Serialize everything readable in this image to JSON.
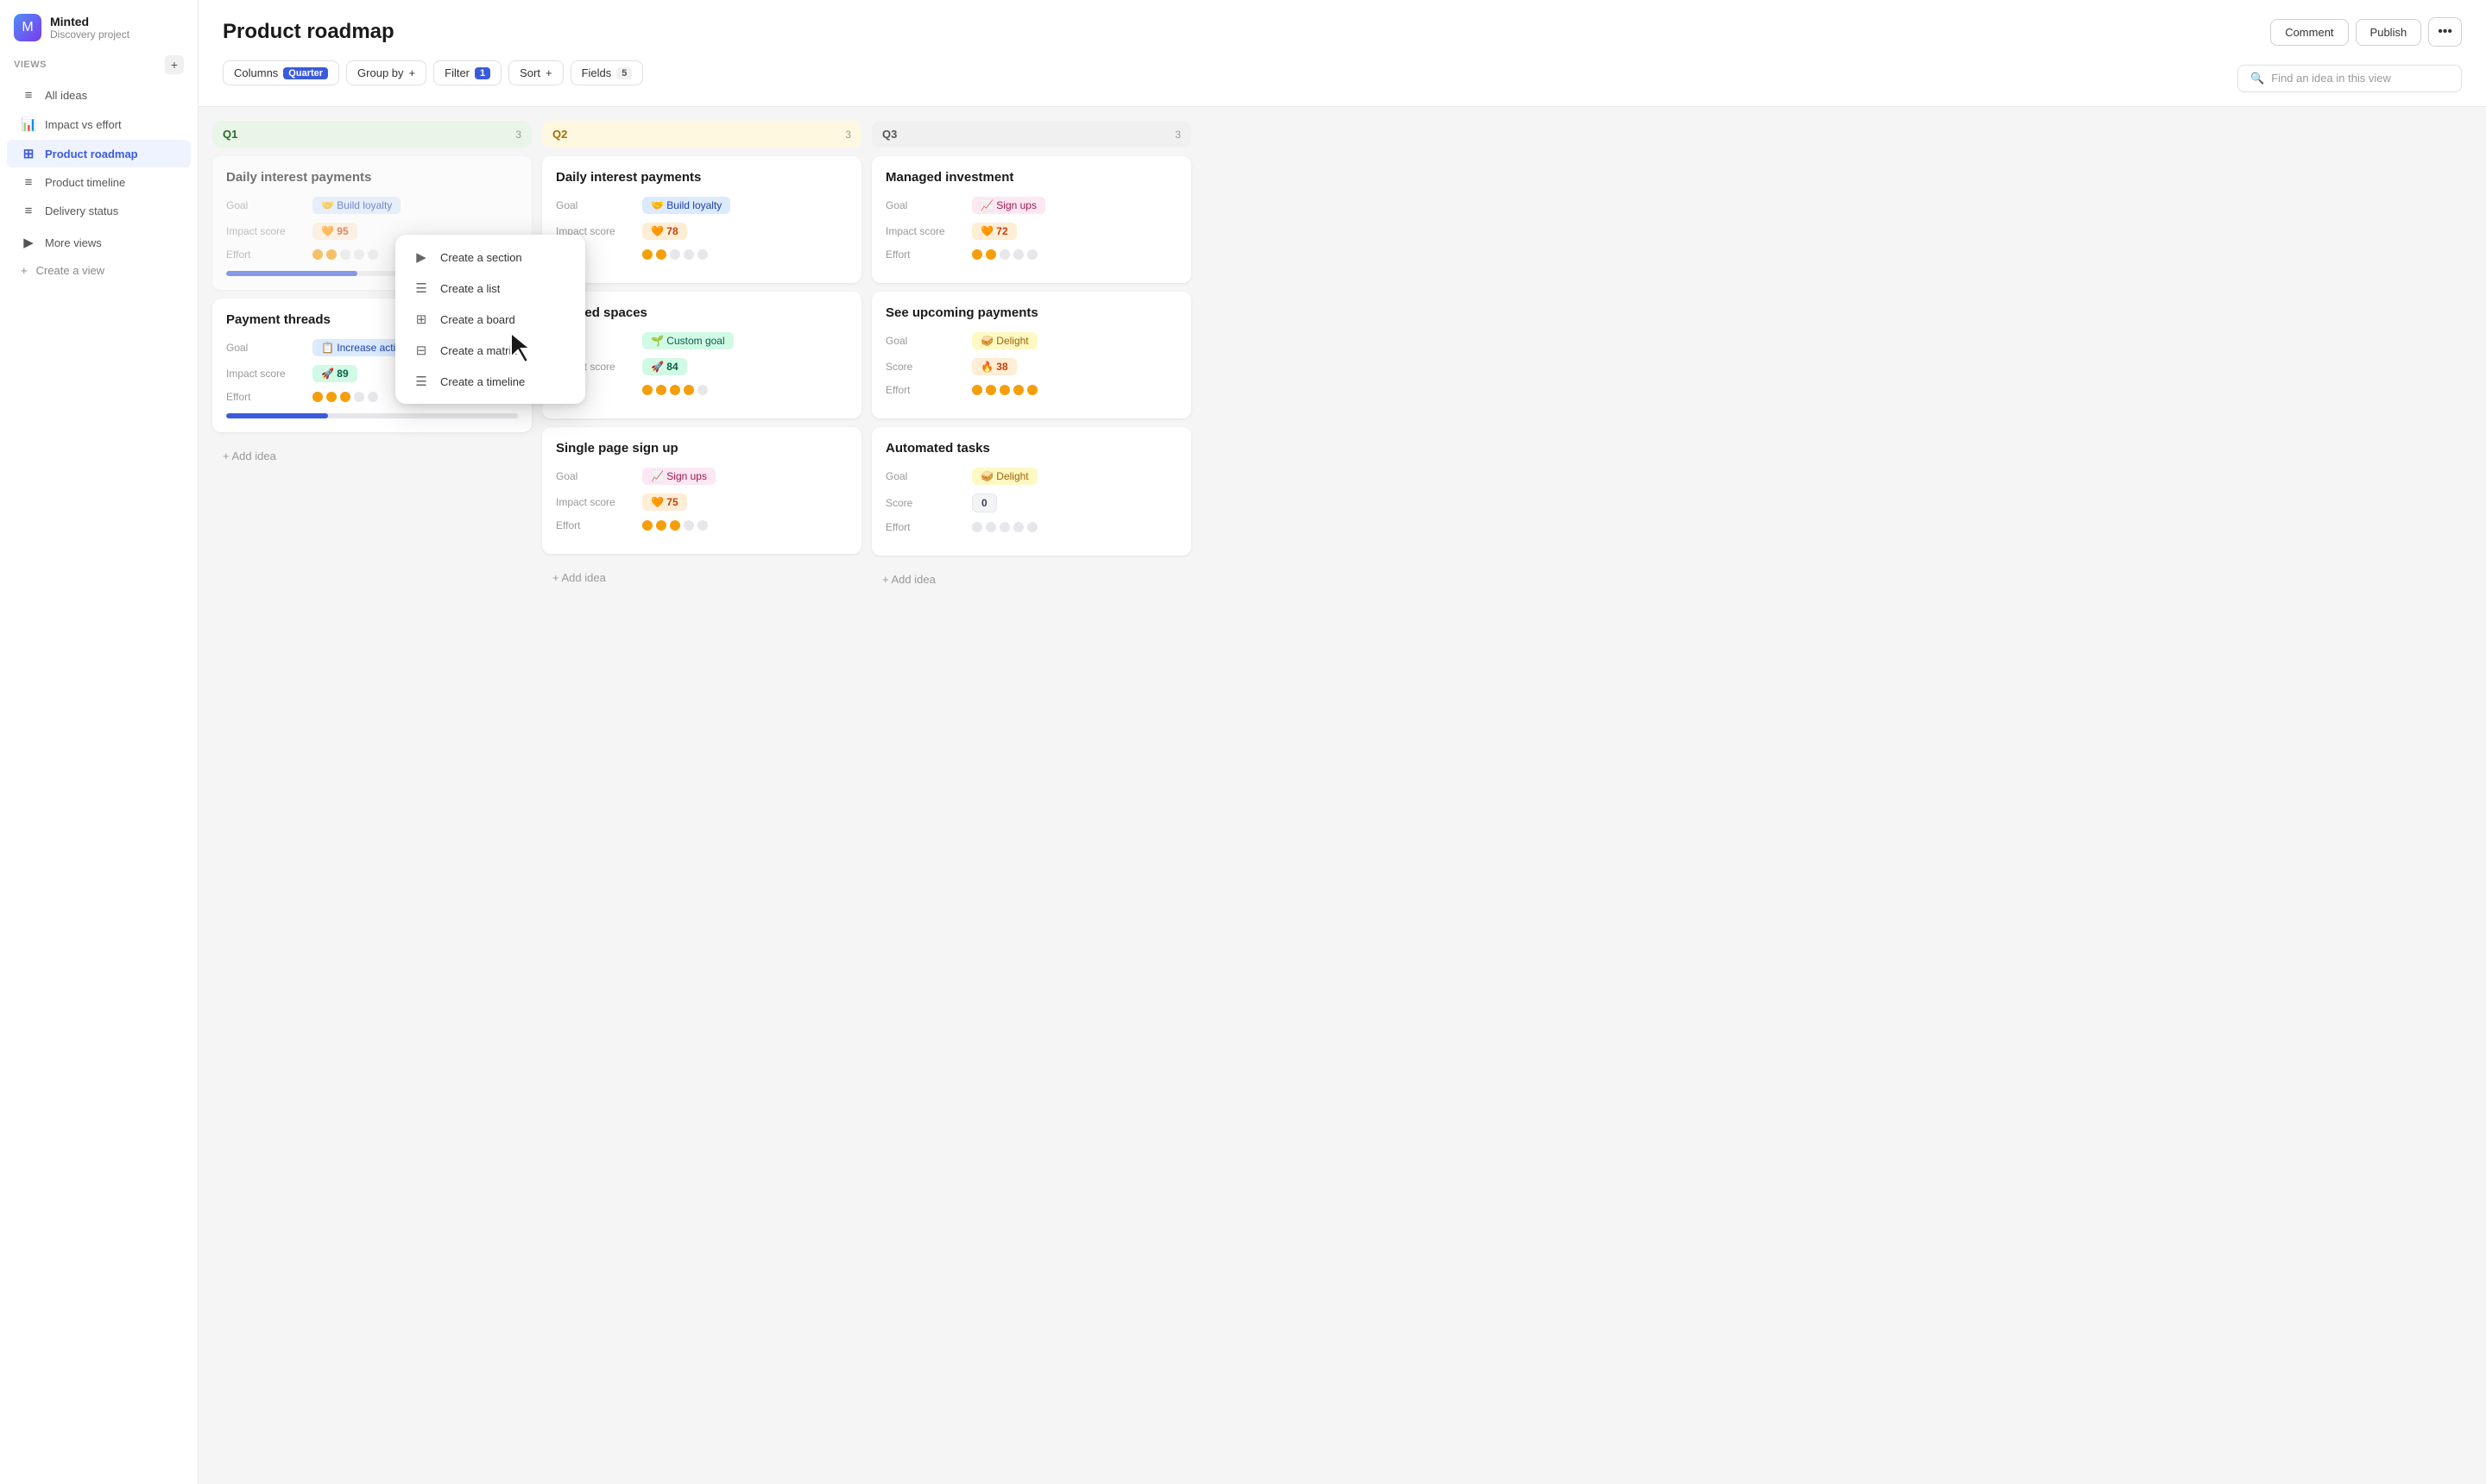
{
  "app": {
    "name": "Minted",
    "project": "Discovery project",
    "logo_emoji": "🟩"
  },
  "sidebar": {
    "views_label": "Views",
    "add_btn": "+",
    "items": [
      {
        "id": "all-ideas",
        "label": "All ideas",
        "icon": "≡",
        "active": false
      },
      {
        "id": "impact-vs-effort",
        "label": "Impact vs effort",
        "icon": "📊",
        "active": false
      },
      {
        "id": "product-roadmap",
        "label": "Product roadmap",
        "icon": "⊞",
        "active": true
      },
      {
        "id": "product-timeline",
        "label": "Product timeline",
        "icon": "≡",
        "active": false
      },
      {
        "id": "delivery-status",
        "label": "Delivery status",
        "icon": "≡",
        "active": false
      }
    ],
    "more_views_label": "More views",
    "create_view_label": "Create a view"
  },
  "header": {
    "title": "Product roadmap",
    "comment_btn": "Comment",
    "publish_btn": "Publish",
    "more_btn": "•••"
  },
  "toolbar": {
    "columns_label": "Columns",
    "columns_value": "Quarter",
    "group_by_label": "Group by",
    "group_by_icon": "+",
    "filter_label": "Filter",
    "filter_count": "1",
    "sort_label": "Sort",
    "sort_icon": "+",
    "fields_label": "Fields",
    "fields_count": "5",
    "search_placeholder": "Find an idea in this view"
  },
  "dropdown": {
    "items": [
      {
        "id": "section",
        "icon": "▶",
        "label": "Create a section"
      },
      {
        "id": "list",
        "icon": "☰",
        "label": "Create a list"
      },
      {
        "id": "board",
        "icon": "⊞",
        "label": "Create a board"
      },
      {
        "id": "matrix",
        "icon": "⊟",
        "label": "Create a matrix"
      },
      {
        "id": "timeline",
        "icon": "☰",
        "label": "Create a timeline"
      }
    ]
  },
  "columns": [
    {
      "id": "q1",
      "label": "Q1",
      "count": 3,
      "style": "q1",
      "cards": [
        {
          "id": "card-build-loyalty",
          "title": "Daily interest payments",
          "goal_emoji": "🤝",
          "goal_label": "Build loyalty",
          "goal_style": "blue",
          "score_emoji": "🧡",
          "score_value": "95",
          "score_style": "orange",
          "effort_dots": [
            true,
            true,
            false,
            false,
            false
          ],
          "progress": 45,
          "partial": true
        },
        {
          "id": "card-payment-threads",
          "title": "Payment threads",
          "goal_emoji": "📋",
          "goal_label": "Increase active use",
          "goal_style": "blue",
          "score_emoji": "🚀",
          "score_value": "89",
          "score_style": "green",
          "effort_dots": [
            true,
            true,
            true,
            false,
            false
          ],
          "progress": 35,
          "partial": false
        }
      ]
    },
    {
      "id": "q2",
      "label": "Q2",
      "count": 3,
      "style": "q2",
      "cards": [
        {
          "id": "card-daily-interest",
          "title": "Daily interest payments",
          "goal_emoji": "🤝",
          "goal_label": "Build loyalty",
          "goal_style": "blue",
          "score_emoji": "🧡",
          "score_value": "78",
          "score_style": "orange",
          "effort_dots": [
            true,
            true,
            false,
            false,
            false
          ],
          "progress": null
        },
        {
          "id": "card-shared-spaces",
          "title": "Shared spaces",
          "goal_emoji": "🌱",
          "goal_label": "Custom goal",
          "goal_style": "green",
          "score_emoji": "🚀",
          "score_value": "84",
          "score_style": "green",
          "effort_dots": [
            true,
            true,
            true,
            true,
            false
          ],
          "progress": null
        },
        {
          "id": "card-single-page",
          "title": "Single page sign up",
          "goal_emoji": "📈",
          "goal_label": "Sign ups",
          "goal_style": "pink",
          "score_emoji": "🧡",
          "score_value": "75",
          "score_style": "orange",
          "effort_dots": [
            true,
            true,
            true,
            false,
            false
          ],
          "progress": null
        }
      ]
    },
    {
      "id": "q3",
      "label": "Q3",
      "count": 3,
      "style": "q3",
      "cards": [
        {
          "id": "card-managed-investment",
          "title": "Managed investment",
          "goal_emoji": "📈",
          "goal_label": "Sign ups",
          "goal_style": "pink",
          "score_emoji": "🧡",
          "score_value": "72",
          "score_style": "orange",
          "effort_dots": [
            true,
            true,
            false,
            false,
            false
          ],
          "progress": null
        },
        {
          "id": "card-upcoming-payments",
          "title": "See upcoming payments",
          "goal_emoji": "🥪",
          "goal_label": "Delight",
          "goal_style": "yellow",
          "score_label": "Score",
          "score_emoji": "🔥",
          "score_value": "38",
          "score_style": "orange",
          "effort_dots": [
            true,
            true,
            true,
            true,
            true
          ],
          "progress": null
        },
        {
          "id": "card-automated-tasks",
          "title": "Automated tasks",
          "goal_emoji": "🥪",
          "goal_label": "Delight",
          "goal_style": "yellow",
          "score_label": "Score",
          "score_emoji": null,
          "score_value": "0",
          "score_style": "gray",
          "effort_dots": [
            false,
            false,
            false,
            false,
            false
          ],
          "progress": null
        }
      ]
    }
  ],
  "add_idea_label": "+ Add idea"
}
